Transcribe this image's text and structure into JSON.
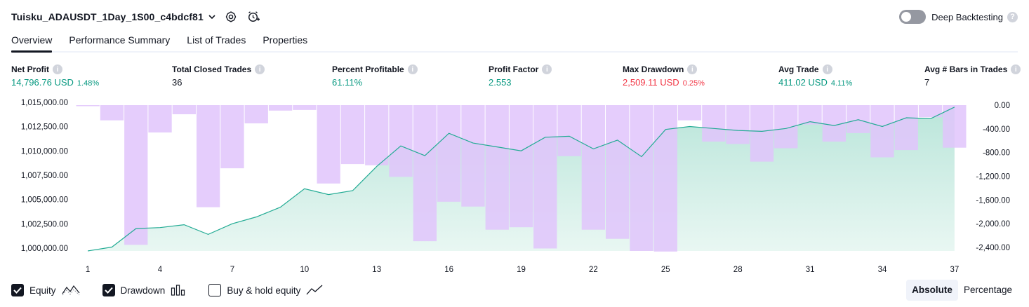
{
  "header": {
    "strategy_name": "Tuisku_ADAUSDT_1Day_1S00_c4bdcf81",
    "deep_backtesting_label": "Deep Backtesting"
  },
  "tabs": [
    {
      "label": "Overview",
      "active": true
    },
    {
      "label": "Performance Summary",
      "active": false
    },
    {
      "label": "List of Trades",
      "active": false
    },
    {
      "label": "Properties",
      "active": false
    }
  ],
  "metrics": {
    "net_profit": {
      "label": "Net Profit",
      "value": "14,796.76 USD",
      "pct": "1.48%"
    },
    "total_closed_trades": {
      "label": "Total Closed Trades",
      "value": "36"
    },
    "percent_profitable": {
      "label": "Percent Profitable",
      "value": "61.11%"
    },
    "profit_factor": {
      "label": "Profit Factor",
      "value": "2.553"
    },
    "max_drawdown": {
      "label": "Max Drawdown",
      "value": "2,509.11 USD",
      "pct": "0.25%"
    },
    "avg_trade": {
      "label": "Avg Trade",
      "value": "411.02 USD",
      "pct": "4.11%"
    },
    "avg_bars": {
      "label": "Avg # Bars in Trades",
      "value": "7"
    }
  },
  "colors": {
    "equity_line": "#22ab94",
    "equity_fill": "#c9ece4",
    "drawdown_bar": "#e1c4fb",
    "positive": "#089981",
    "negative": "#f23645"
  },
  "legend": {
    "equity_label": "Equity",
    "equity_checked": true,
    "drawdown_label": "Drawdown",
    "drawdown_checked": true,
    "buyhold_label": "Buy & hold equity",
    "buyhold_checked": false
  },
  "view_toggle": {
    "absolute_label": "Absolute",
    "percentage_label": "Percentage",
    "selected": "Absolute"
  },
  "chart_data": {
    "type": "area",
    "x_ticks": [
      "1",
      "4",
      "7",
      "10",
      "13",
      "16",
      "19",
      "22",
      "25",
      "28",
      "31",
      "34",
      "37"
    ],
    "left_axis": {
      "ticks": [
        "1,015,000.00",
        "1,012,500.00",
        "1,010,000.00",
        "1,007,500.00",
        "1,005,000.00",
        "1,002,500.00",
        "1,000,000.00"
      ],
      "range": [
        1000000,
        1015000
      ]
    },
    "right_axis": {
      "ticks": [
        "0.00",
        "-400.00",
        "-800.00",
        "-1,200.00",
        "-1,600.00",
        "-2,000.00",
        "-2,400.00"
      ],
      "range": [
        -2400,
        0
      ]
    },
    "series": [
      {
        "name": "Equity",
        "type": "area",
        "x": [
          1,
          2,
          3,
          4,
          5,
          6,
          7,
          8,
          9,
          10,
          11,
          12,
          13,
          14,
          15,
          16,
          17,
          18,
          19,
          20,
          21,
          22,
          23,
          24,
          25,
          26,
          27,
          28,
          29,
          30,
          31,
          32,
          33,
          34,
          35,
          36,
          37
        ],
        "values": [
          1000000,
          1000400,
          1002300,
          1002400,
          1002700,
          1001700,
          1002800,
          1003500,
          1004500,
          1006400,
          1005800,
          1006200,
          1008700,
          1010800,
          1009800,
          1012100,
          1011100,
          1010700,
          1010300,
          1011700,
          1011800,
          1010500,
          1011400,
          1009700,
          1012500,
          1012800,
          1012600,
          1012400,
          1012300,
          1012600,
          1013300,
          1012900,
          1013500,
          1012800,
          1013700,
          1013600,
          1014800
        ]
      },
      {
        "name": "Drawdown",
        "type": "bar",
        "x": [
          1,
          2,
          3,
          4,
          5,
          6,
          7,
          8,
          9,
          10,
          11,
          12,
          13,
          14,
          15,
          16,
          17,
          18,
          19,
          20,
          21,
          22,
          23,
          24,
          25,
          26,
          27,
          28,
          29,
          30,
          31,
          32,
          33,
          34,
          35,
          36,
          37
        ],
        "values": [
          0,
          -250,
          -2300,
          -450,
          -150,
          -1680,
          -1040,
          -300,
          -90,
          -80,
          -1290,
          -970,
          -990,
          -1180,
          -2240,
          -1590,
          -1670,
          -2050,
          -2010,
          -2360,
          -840,
          -2050,
          -2200,
          -2400,
          -2410,
          -250,
          -600,
          -640,
          -930,
          -710,
          -320,
          -600,
          -460,
          -860,
          -740,
          -200,
          -700
        ]
      }
    ],
    "grid": false,
    "legend_position": "bottom-left"
  }
}
